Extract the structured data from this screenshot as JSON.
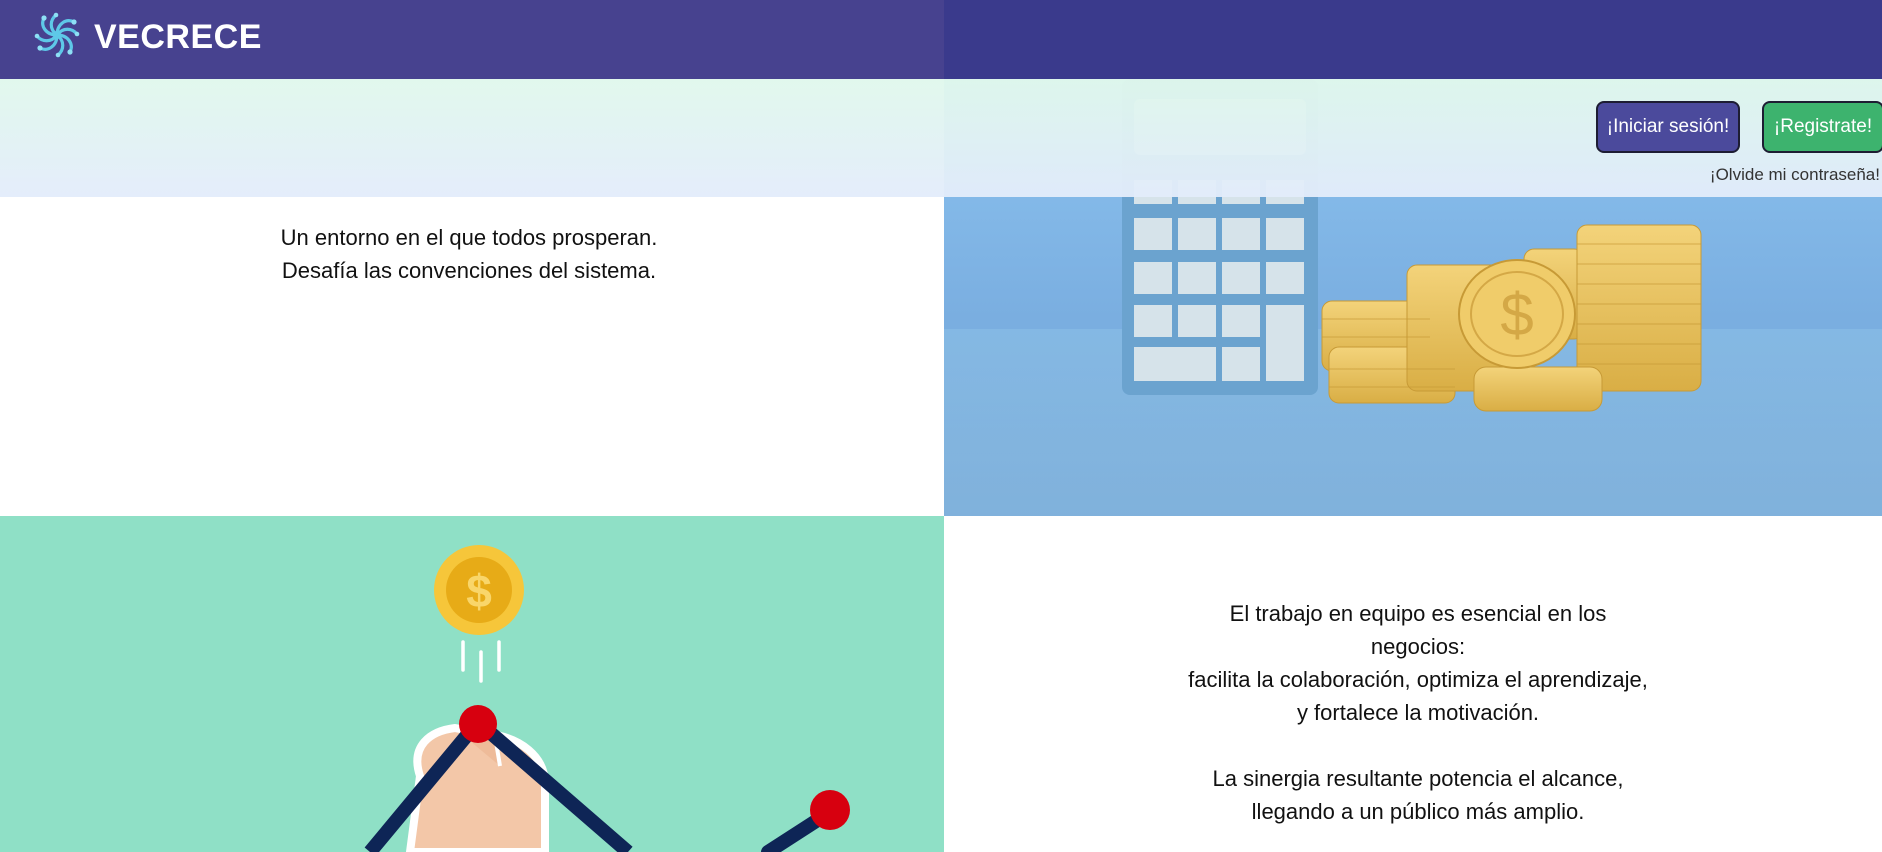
{
  "header": {
    "brand_name": "VECRECE",
    "logo_icon": "swirl-logo-icon",
    "colors": {
      "left_bg": "#47428f",
      "right_bg": "#3a3a8c"
    }
  },
  "auth": {
    "login_label": "¡Iniciar sesión!",
    "register_label": "¡Registrate!",
    "forgot_label": "¡Olvide mi contraseña!",
    "colors": {
      "login": "#4b4a9c",
      "register": "#3db36e"
    }
  },
  "hero": {
    "tagline_line1": "Un entorno en el que todos prosperan.",
    "tagline_line2": "Desafía las convenciones del sistema.",
    "image_icon": "calculator-coins-image"
  },
  "growth": {
    "image_icon": "hand-drawing-chart-coin-image",
    "coin_symbol": "$",
    "bg_color": "#8fe0c6"
  },
  "teamwork": {
    "lines": [
      "El trabajo en equipo es esencial en los",
      "negocios:",
      "facilita la colaboración, optimiza el aprendizaje,",
      "y fortalece la motivación.",
      "",
      "La sinergia resultante potencia el alcance,",
      "llegando a un público más amplio."
    ]
  }
}
